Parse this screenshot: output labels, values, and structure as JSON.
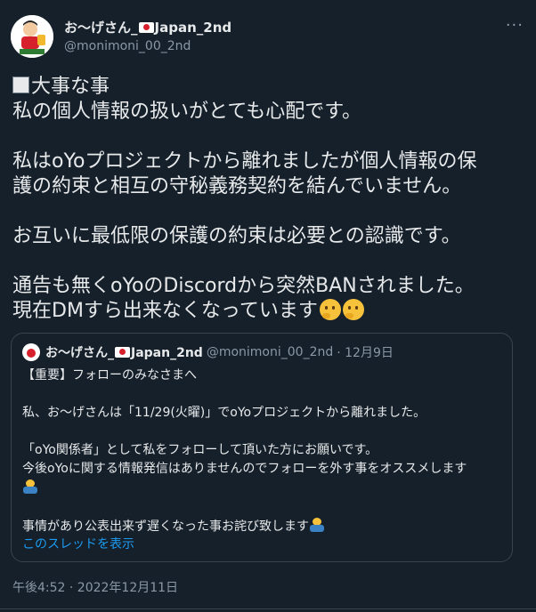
{
  "author": {
    "name_prefix": "お〜げさん_",
    "name_suffix": "Japan_2nd",
    "handle": "@monimoni_00_2nd"
  },
  "tweet": {
    "lines": [
      "大事な事",
      "私の個人情報の扱いがとても心配です。",
      "",
      "私はoYoプロジェクトから離れましたが個人情報の保",
      "護の約束と相互の守秘義務契約を結んでいません。",
      "",
      "お互いに最低限の保護の約束は必要との認識です。",
      "",
      "通告も無くoYoのDiscordから突然BANされました。",
      "現在DMすら出来なくなっています"
    ]
  },
  "quote": {
    "name_prefix": "お〜げさん_",
    "name_suffix": "Japan_2nd",
    "handle": "@monimoni_00_2nd",
    "date": "· 12月9日",
    "lines": [
      "【重要】フォローのみなさまへ",
      "",
      "私、お〜げさんは「11/29(火曜)」でoYoプロジェクトから離れました。",
      "",
      "「oYo関係者」として私をフォローして頂いた方にお願いです。",
      "今後oYoに関する情報発信はありませんのでフォローを外す事をオススメします",
      "",
      "",
      "事情があり公表出来ず遅くなった事お詫び致します"
    ],
    "show_thread": "このスレッドを表示"
  },
  "timestamp": "午後4:52 · 2022年12月11日",
  "icons": [
    "avatar",
    "japan-flag-icon",
    "more-icon",
    "white-square-icon",
    "thinking-face-icon",
    "bowing-man-icon"
  ],
  "colors": {
    "background": "#15202b",
    "text": "#e7e9ea",
    "secondary": "#8b98a5",
    "link": "#1d9bf0",
    "border": "#38444d"
  }
}
